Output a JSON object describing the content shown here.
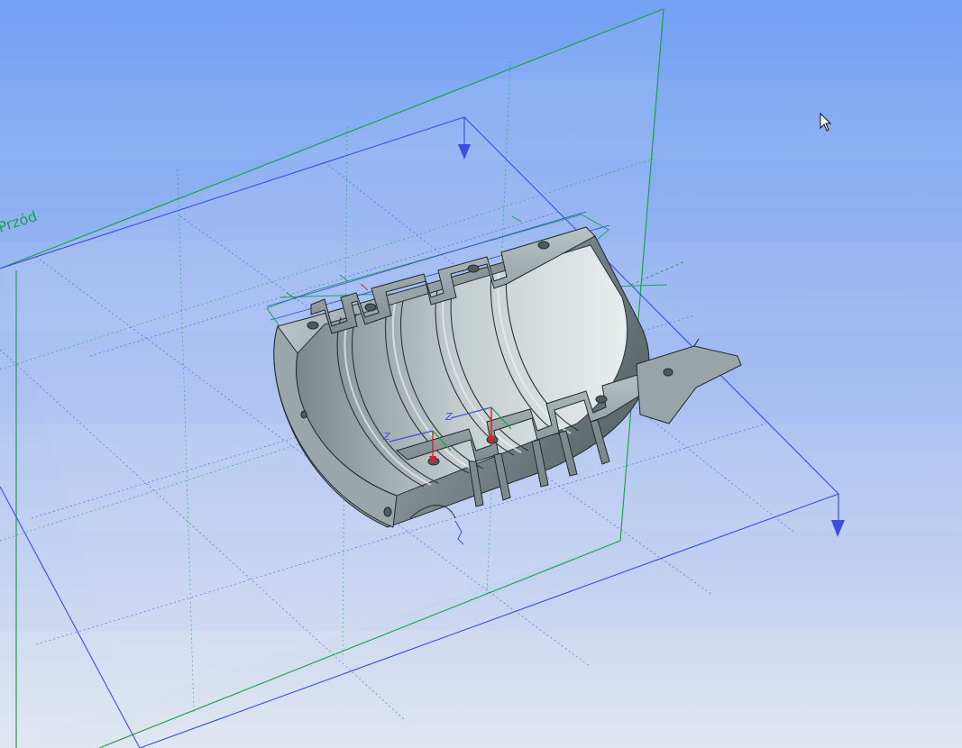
{
  "view": {
    "background_top": "#73a1f3",
    "background_bottom": "#dde4ee"
  },
  "planes": {
    "front": {
      "label": "Przód",
      "color": "#16a34a"
    },
    "top": {
      "color": "#3b4ee0"
    }
  },
  "part": {
    "body_color": "#a7b3b6",
    "shade_color": "#6e7b80",
    "highlight_color": "#e7eeee",
    "edge_color": "#1f2a2e"
  },
  "triads": {
    "left": {
      "z_label": "Z"
    },
    "right": {
      "z_label": "Z"
    }
  },
  "icons": {
    "triad_arrow": "arrow-icon",
    "plane_normal": "down-arrow-icon",
    "cursor": "mouse-pointer-icon"
  }
}
